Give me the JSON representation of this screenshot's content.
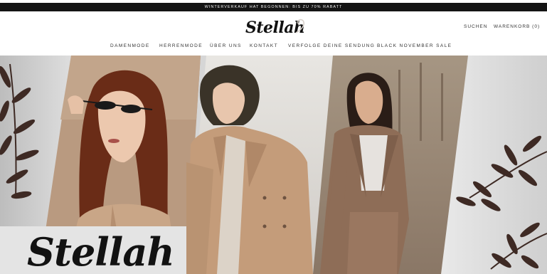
{
  "announcement": "WINTERVERKAUF HAT BEGONNEN: BIS ZU 70% RABATT",
  "header": {
    "logo_text": "Stellah",
    "search_label": "SUCHEN",
    "cart_label": "WARENKORB (0)"
  },
  "nav": {
    "items": [
      {
        "label": "DAMENMODE"
      },
      {
        "label": "HERRENMODE"
      },
      {
        "label": "ÜBER UNS"
      },
      {
        "label": "KONTAKT"
      },
      {
        "label": "VERFOLGE DEINE SENDUNG"
      },
      {
        "label": "BLACK NOVEMBER SALE"
      }
    ]
  },
  "hero": {
    "brand_text": "Stellah",
    "colors": {
      "background": "#d6d6d6",
      "panel_tan": "#b99a80",
      "coat": "#c49c7a",
      "leaf": "#3e2a24",
      "text": "#121212"
    }
  }
}
